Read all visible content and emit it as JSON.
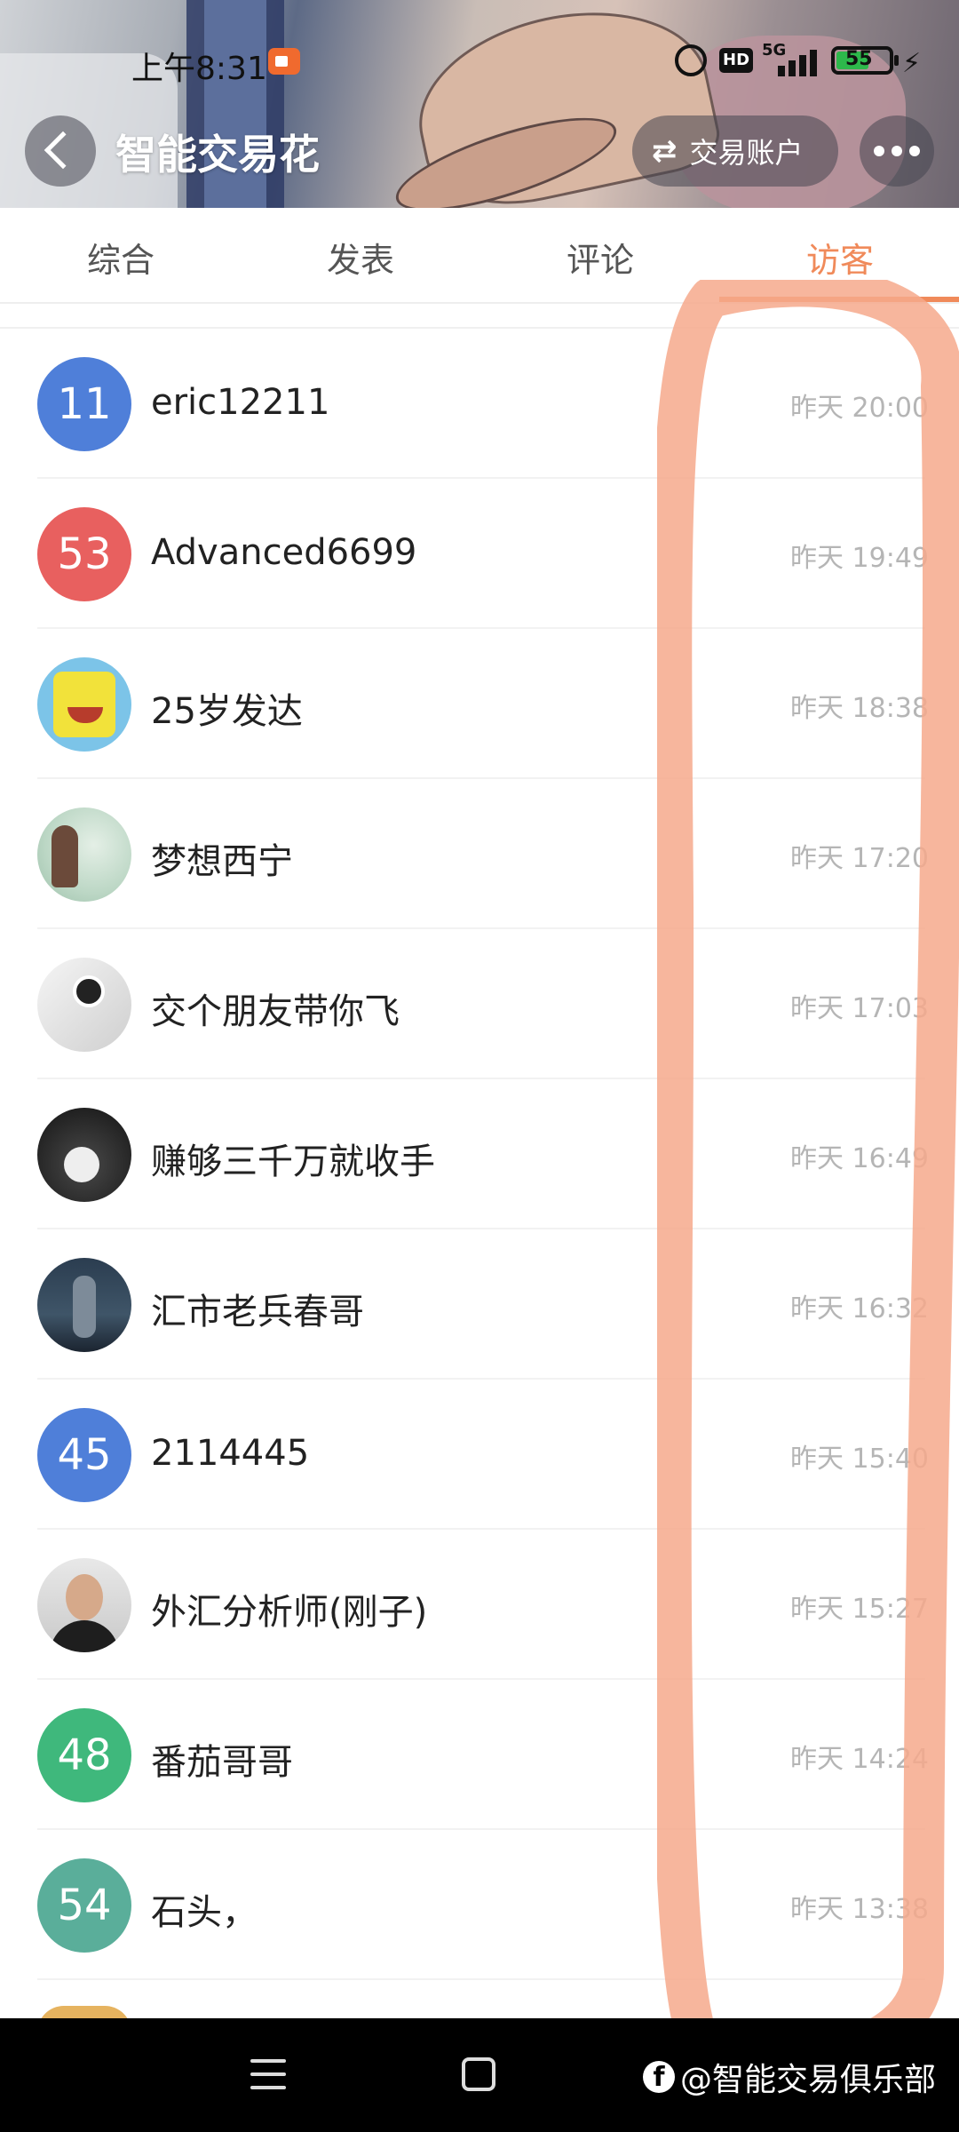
{
  "status": {
    "time": "上午8:31",
    "hd": "HD",
    "network": "5G",
    "battery": "55"
  },
  "header": {
    "title": "智能交易花",
    "account_button": "交易账户"
  },
  "tabs": [
    "综合",
    "发表",
    "评论",
    "访客"
  ],
  "active_tab": 3,
  "visitors": [
    {
      "name": "eric12211",
      "time": "昨天 20:00",
      "badge": "11",
      "color": "#4f7fd9"
    },
    {
      "name": "Advanced6699",
      "time": "昨天 19:49",
      "badge": "53",
      "color": "#e8605f"
    },
    {
      "name": "25岁发达",
      "time": "昨天 18:38",
      "avatar": "spongebob-avatar"
    },
    {
      "name": "梦想西宁",
      "time": "昨天 17:20",
      "avatar": "doll-avatar"
    },
    {
      "name": "交个朋友带你飞",
      "time": "昨天 17:03",
      "avatar": "hand-avatar"
    },
    {
      "name": "赚够三千万就收手",
      "time": "昨天 16:49",
      "avatar": "man-avatar"
    },
    {
      "name": "汇市老兵春哥",
      "time": "昨天 16:32",
      "avatar": "night-avatar"
    },
    {
      "name": "2114445",
      "time": "昨天 15:40",
      "badge": "45",
      "color": "#4f7fd9"
    },
    {
      "name": "外汇分析师(刚子)",
      "time": "昨天 15:27",
      "avatar": "portrait-avatar"
    },
    {
      "name": "番茄哥哥",
      "time": "昨天 14:24",
      "badge": "48",
      "color": "#3fb87c"
    },
    {
      "name": "石头，",
      "time": "昨天 13:38",
      "badge": "54",
      "color": "#5aae9a"
    }
  ],
  "watermark": "@智能交易俱乐部",
  "accent_color": "#f08a5a"
}
